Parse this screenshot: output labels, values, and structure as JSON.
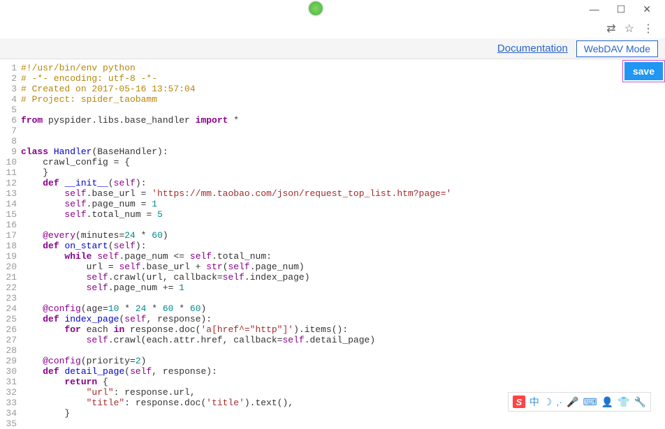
{
  "window": {
    "min": "—",
    "max": "☐",
    "close": "✕"
  },
  "browser": {
    "translate": "⇄",
    "star": "☆",
    "menu": "⋮"
  },
  "header": {
    "doc": "Documentation",
    "webdav": "WebDAV Mode"
  },
  "save": "save",
  "code": {
    "lines": [
      {
        "n": "1",
        "h": "<span class='cm-comment'>#!/usr/bin/env python</span>"
      },
      {
        "n": "2",
        "h": "<span class='cm-comment'># -*- encoding: utf-8 -*-</span>"
      },
      {
        "n": "3",
        "h": "<span class='cm-comment'># Created on 2017-05-16 13:57:04</span>"
      },
      {
        "n": "4",
        "h": "<span class='cm-comment'># Project: spider_taobamm</span>"
      },
      {
        "n": "5",
        "h": ""
      },
      {
        "n": "6",
        "h": "<span class='cm-keyword'>from</span> pyspider.libs.base_handler <span class='cm-keyword'>import</span> *"
      },
      {
        "n": "7",
        "h": ""
      },
      {
        "n": "8",
        "h": ""
      },
      {
        "n": "9",
        "h": "<span class='cm-keyword'>class</span> <span class='cm-def'>Handler</span>(BaseHandler):"
      },
      {
        "n": "10",
        "h": "    crawl_config = {"
      },
      {
        "n": "11",
        "h": "    }"
      },
      {
        "n": "12",
        "h": "    <span class='cm-keyword'>def</span> <span class='cm-def'>__init__</span>(<span class='cm-self'>self</span>):"
      },
      {
        "n": "13",
        "h": "        <span class='cm-self'>self</span>.base_url = <span class='cm-string'>'https://mm.taobao.com/json/request_top_list.htm?page='</span>"
      },
      {
        "n": "14",
        "h": "        <span class='cm-self'>self</span>.page_num = <span class='cm-number'>1</span>"
      },
      {
        "n": "15",
        "h": "        <span class='cm-self'>self</span>.total_num = <span class='cm-number'>5</span>"
      },
      {
        "n": "16",
        "h": ""
      },
      {
        "n": "17",
        "h": "    <span class='cm-decorator'>@every</span>(minutes=<span class='cm-number'>24</span> * <span class='cm-number'>60</span>)"
      },
      {
        "n": "18",
        "h": "    <span class='cm-keyword'>def</span> <span class='cm-def'>on_start</span>(<span class='cm-self'>self</span>):"
      },
      {
        "n": "19",
        "h": "        <span class='cm-keyword'>while</span> <span class='cm-self'>self</span>.page_num &lt;= <span class='cm-self'>self</span>.total_num:"
      },
      {
        "n": "20",
        "h": "            url = <span class='cm-self'>self</span>.base_url + <span class='cm-builtin'>str</span>(<span class='cm-self'>self</span>.page_num)"
      },
      {
        "n": "21",
        "h": "            <span class='cm-self'>self</span>.crawl(url, callback=<span class='cm-self'>self</span>.index_page)"
      },
      {
        "n": "22",
        "h": "            <span class='cm-self'>self</span>.page_num += <span class='cm-number'>1</span>"
      },
      {
        "n": "23",
        "h": ""
      },
      {
        "n": "24",
        "h": "    <span class='cm-decorator'>@config</span>(age=<span class='cm-number'>10</span> * <span class='cm-number'>24</span> * <span class='cm-number'>60</span> * <span class='cm-number'>60</span>)"
      },
      {
        "n": "25",
        "h": "    <span class='cm-keyword'>def</span> <span class='cm-def'>index_page</span>(<span class='cm-self'>self</span>, response):"
      },
      {
        "n": "26",
        "h": "        <span class='cm-keyword'>for</span> each <span class='cm-keyword'>in</span> response.doc(<span class='cm-string'>'a[href^=\"http\"]'</span>).items():"
      },
      {
        "n": "27",
        "h": "            <span class='cm-self'>self</span>.crawl(each.attr.href, callback=<span class='cm-self'>self</span>.detail_page)"
      },
      {
        "n": "28",
        "h": ""
      },
      {
        "n": "29",
        "h": "    <span class='cm-decorator'>@config</span>(priority=<span class='cm-number'>2</span>)"
      },
      {
        "n": "30",
        "h": "    <span class='cm-keyword'>def</span> <span class='cm-def'>detail_page</span>(<span class='cm-self'>self</span>, response):"
      },
      {
        "n": "31",
        "h": "        <span class='cm-keyword'>return</span> {"
      },
      {
        "n": "32",
        "h": "            <span class='cm-string'>\"url\"</span>: response.url,"
      },
      {
        "n": "33",
        "h": "            <span class='cm-string'>\"title\"</span>: response.doc(<span class='cm-string'>'title'</span>).text(),"
      },
      {
        "n": "34",
        "h": "        }"
      },
      {
        "n": "35",
        "h": ""
      }
    ]
  },
  "ime": {
    "logo": "S",
    "lang": "中",
    "moon": "☽",
    "comma": ",·",
    "mic": "🎤",
    "kbd": "⌨",
    "person": "👤",
    "shirt": "👕",
    "wrench": "🔧"
  }
}
